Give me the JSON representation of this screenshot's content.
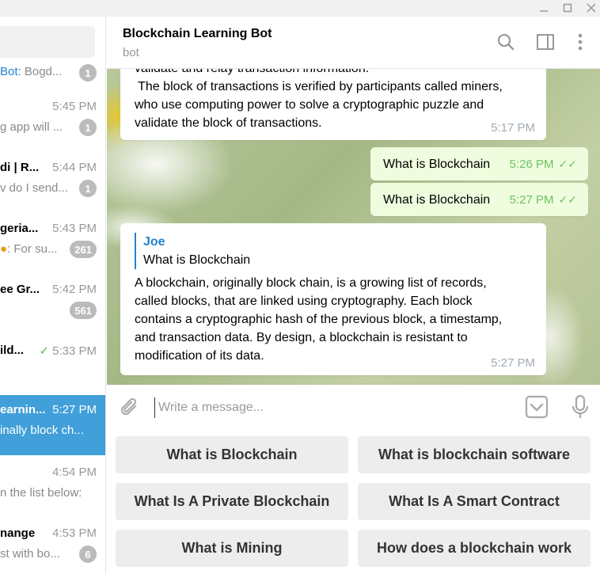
{
  "window": {
    "controls": [
      "minimize",
      "maximize",
      "close"
    ]
  },
  "sidebar": {
    "chats": [
      {
        "name": "",
        "sender": "Bot:",
        "preview": " Bogd...",
        "time": "",
        "badge": "1"
      },
      {
        "name": "",
        "sender": "",
        "preview": "g app will ...",
        "time": "5:45 PM",
        "badge": "1"
      },
      {
        "name": "di | R...",
        "sender": "",
        "preview": "v do I send...",
        "time": "5:44 PM",
        "badge": "1"
      },
      {
        "name": "geria...",
        "sender": "",
        "preview": ": For su...",
        "time": "5:43 PM",
        "badge": "261"
      },
      {
        "name": "ee Gr...",
        "sender": "",
        "preview": "",
        "time": "5:42 PM",
        "badge": "561"
      },
      {
        "name": "ild...",
        "sender": "",
        "preview": "",
        "time": "5:33 PM",
        "badge": ""
      },
      {
        "name": "earnin...",
        "sender": "",
        "preview": "inally block ch...",
        "time": "5:27 PM",
        "badge": ""
      },
      {
        "name": "",
        "sender": "",
        "preview": "n the list below:",
        "time": "4:54 PM",
        "badge": ""
      },
      {
        "name": "nange",
        "sender": "",
        "preview": "st with bo...",
        "time": "4:53 PM",
        "badge": "6"
      }
    ]
  },
  "header": {
    "title": "Blockchain Learning Bot",
    "subtitle": "bot"
  },
  "messages": {
    "m1": {
      "lines": [
        "validate and relay transaction information.",
        " The block of transactions is verified by participants called miners,",
        "who use computing power to solve a cryptographic puzzle and",
        "validate the block of transactions."
      ],
      "time": "5:17 PM"
    },
    "m2": {
      "text": "What is Blockchain",
      "time": "5:26 PM"
    },
    "m3": {
      "text": "What is Blockchain",
      "time": "5:27 PM"
    },
    "m4": {
      "reply_author": "Joe",
      "reply_text": "What is Blockchain",
      "lines": [
        "A blockchain, originally block chain, is a growing list of records,",
        "called blocks, that are linked using cryptography. Each block",
        "contains a cryptographic hash of the previous block, a timestamp,",
        "and transaction data. By design, a blockchain is resistant to",
        "modification of its data."
      ],
      "time": "5:27 PM"
    }
  },
  "composer": {
    "placeholder": "Write a message..."
  },
  "keyboard": {
    "buttons": [
      "What is Blockchain",
      "What is blockchain software",
      "What Is A Private Blockchain",
      "What Is A Smart Contract",
      "What is Mining",
      "How does a blockchain work"
    ]
  },
  "colors": {
    "accent": "#419fd9",
    "outgoing_bubble": "#effdde",
    "link": "#2481cc",
    "read_check": "#6cc264"
  }
}
